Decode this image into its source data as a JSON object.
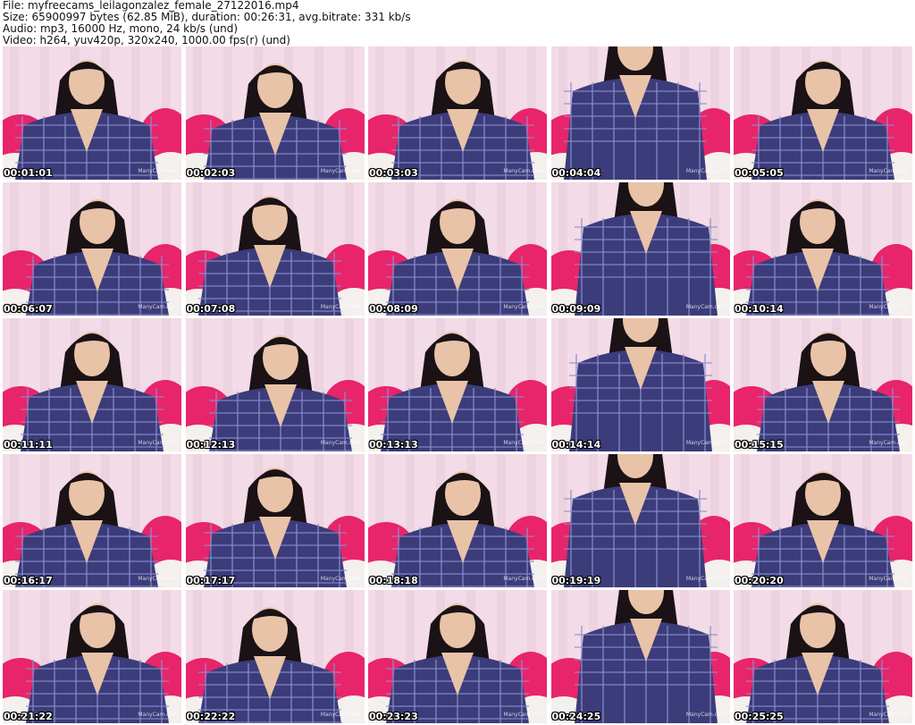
{
  "header": {
    "file_line": "File: myfreecams_leilagonzalez_female_27122016.mp4",
    "size_line": "Size: 65900997 bytes (62.85 MiB), duration: 00:26:31, avg.bitrate: 331 kb/s",
    "audio_line": "Audio: mp3, 16000 Hz, mono, 24 kb/s (und)",
    "video_line": "Video: h264, yuv420p, 320x240, 1000.00 fps(r) (und)"
  },
  "watermark": "ManyCam.com",
  "colors": {
    "background": "#ffffff",
    "shirt": "#3c3c7a",
    "plaid_line": "#8a8fd0",
    "wall": "#f3dbe7",
    "pillow": "#e8246a",
    "hair": "#1a1214",
    "skin": "#e9c3a8"
  },
  "thumbnails": [
    {
      "timestamp": "00:01:01"
    },
    {
      "timestamp": "00:02:03"
    },
    {
      "timestamp": "00:03:03"
    },
    {
      "timestamp": "00:04:04"
    },
    {
      "timestamp": "00:05:05"
    },
    {
      "timestamp": "00:06:07"
    },
    {
      "timestamp": "00:07:08"
    },
    {
      "timestamp": "00:08:09"
    },
    {
      "timestamp": "00:09:09"
    },
    {
      "timestamp": "00:10:14"
    },
    {
      "timestamp": "00:11:11"
    },
    {
      "timestamp": "00:12:13"
    },
    {
      "timestamp": "00:13:13"
    },
    {
      "timestamp": "00:14:14"
    },
    {
      "timestamp": "00:15:15"
    },
    {
      "timestamp": "00:16:17"
    },
    {
      "timestamp": "00:17:17"
    },
    {
      "timestamp": "00:18:18"
    },
    {
      "timestamp": "00:19:19"
    },
    {
      "timestamp": "00:20:20"
    },
    {
      "timestamp": "00:21:22"
    },
    {
      "timestamp": "00:22:22"
    },
    {
      "timestamp": "00:23:23"
    },
    {
      "timestamp": "00:24:25"
    },
    {
      "timestamp": "00:25:25"
    }
  ]
}
